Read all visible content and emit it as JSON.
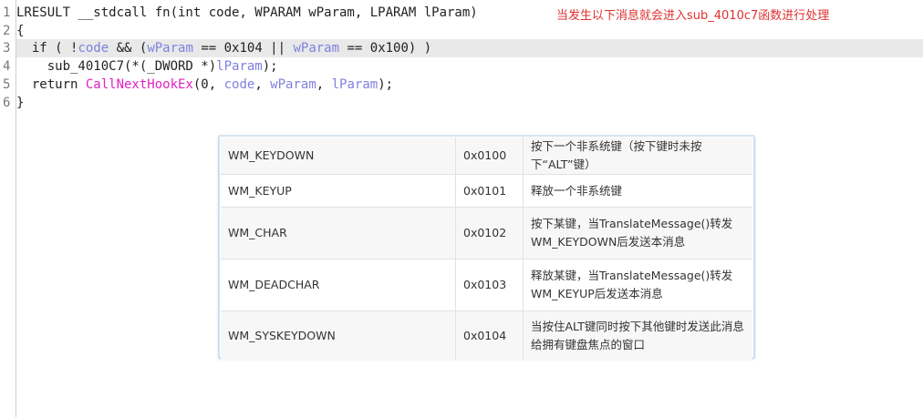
{
  "code": {
    "line_numbers": [
      "1",
      "2",
      "3",
      "4",
      "5",
      "6"
    ],
    "lines": [
      [
        {
          "t": "LRESULT __stdcall fn(int code, WPARAM wParam, LPARAM lParam)",
          "c": "plain"
        }
      ],
      [
        {
          "t": "{",
          "c": "plain"
        }
      ],
      [
        {
          "t": "  if ( !",
          "c": "plain"
        },
        {
          "t": "code",
          "c": "var"
        },
        {
          "t": " && (",
          "c": "plain"
        },
        {
          "t": "wParam",
          "c": "var"
        },
        {
          "t": " == 0x104 || ",
          "c": "plain"
        },
        {
          "t": "wParam",
          "c": "var"
        },
        {
          "t": " == 0x100) )",
          "c": "plain"
        }
      ],
      [
        {
          "t": "    sub_4010C7(*(_DWORD *)",
          "c": "plain"
        },
        {
          "t": "lParam",
          "c": "var"
        },
        {
          "t": ");",
          "c": "plain"
        }
      ],
      [
        {
          "t": "  return ",
          "c": "plain"
        },
        {
          "t": "CallNextHookEx",
          "c": "fn"
        },
        {
          "t": "(0, ",
          "c": "plain"
        },
        {
          "t": "code",
          "c": "var"
        },
        {
          "t": ", ",
          "c": "plain"
        },
        {
          "t": "wParam",
          "c": "var"
        },
        {
          "t": ", ",
          "c": "plain"
        },
        {
          "t": "lParam",
          "c": "var"
        },
        {
          "t": ");",
          "c": "plain"
        }
      ],
      [
        {
          "t": "}",
          "c": "plain"
        }
      ]
    ],
    "highlighted_line": 3
  },
  "annotation": "当发生以下消息就会进入sub_4010c7函数进行处理",
  "colors": {
    "annotation": "#e03030",
    "variable": "#8080e0",
    "function": "#e020c0",
    "highlight": "#e9e9e9"
  },
  "messages_table": {
    "rows": [
      {
        "name": "WM_KEYDOWN",
        "code": "0x0100",
        "desc": "按下一个非系统键（按下键时未按下“ALT”键）"
      },
      {
        "name": "WM_KEYUP",
        "code": "0x0101",
        "desc": "释放一个非系统键"
      },
      {
        "name": "WM_CHAR",
        "code": "0x0102",
        "desc": "按下某键，当TranslateMessage()转发WM_KEYDOWN后发送本消息"
      },
      {
        "name": "WM_DEADCHAR",
        "code": "0x0103",
        "desc": "释放某键，当TranslateMessage()转发WM_KEYUP后发送本消息"
      },
      {
        "name": "WM_SYSKEYDOWN",
        "code": "0x0104",
        "desc": "当按住ALT键同时按下其他键时发送此消息给拥有键盘焦点的窗口"
      }
    ]
  }
}
